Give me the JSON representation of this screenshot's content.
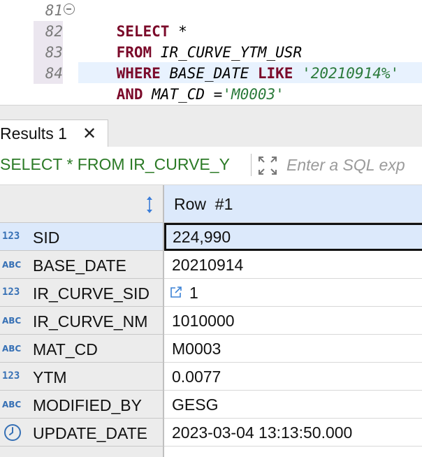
{
  "editor": {
    "lines": [
      {
        "no": "81",
        "tokens": [
          {
            "t": "SELECT",
            "c": "kw"
          },
          {
            "t": " *",
            "c": "plain"
          }
        ]
      },
      {
        "no": "82",
        "tokens": [
          {
            "t": "FROM",
            "c": "kw"
          },
          {
            "t": " IR_CURVE_YTM_USR",
            "c": "id"
          }
        ]
      },
      {
        "no": "83",
        "tokens": [
          {
            "t": "WHERE",
            "c": "kw"
          },
          {
            "t": " BASE_DATE ",
            "c": "id"
          },
          {
            "t": "LIKE",
            "c": "kw"
          },
          {
            "t": " '20210914%'",
            "c": "str"
          }
        ]
      },
      {
        "no": "84",
        "tokens": [
          {
            "t": "AND",
            "c": "kw"
          },
          {
            "t": " MAT_CD ",
            "c": "id"
          },
          {
            "t": "=",
            "c": "plain"
          },
          {
            "t": "'M0003'",
            "c": "str"
          }
        ]
      }
    ]
  },
  "results_tab": {
    "label": "Results 1",
    "close": "✕"
  },
  "filter": {
    "sql_text": "SELECT * FROM IR_CURVE_Y",
    "placeholder": "Enter a SQL exp"
  },
  "grid": {
    "header": "Row  #1",
    "rows": [
      {
        "type": "123",
        "name": "SID",
        "value": "224,990"
      },
      {
        "type": "ABC",
        "name": "BASE_DATE",
        "value": "20210914"
      },
      {
        "type": "123",
        "name": "IR_CURVE_SID",
        "value": "1"
      },
      {
        "type": "ABC",
        "name": "IR_CURVE_NM",
        "value": "1010000"
      },
      {
        "type": "ABC",
        "name": "MAT_CD",
        "value": "M0003"
      },
      {
        "type": "123",
        "name": "YTM",
        "value": "0.0077"
      },
      {
        "type": "ABC",
        "name": "MODIFIED_BY",
        "value": "GESG"
      },
      {
        "type": "clock-icon",
        "name": "UPDATE_DATE",
        "value": "2023-03-04 13:13:50.000"
      }
    ]
  },
  "colors": {
    "keyword": "#7b0a2a",
    "string": "#2a7a3a",
    "selection": "#dce9fb",
    "type_badge": "#3670b5"
  }
}
